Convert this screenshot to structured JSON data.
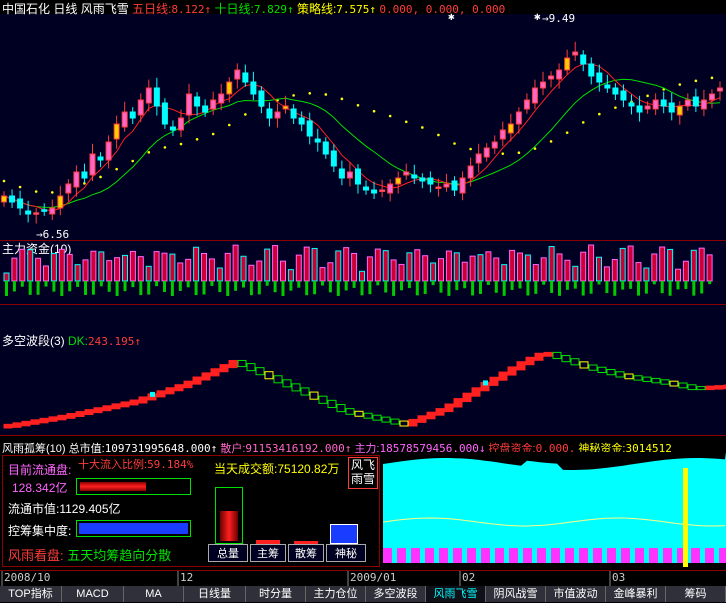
{
  "header": {
    "stock": "中国石化",
    "period": "日线",
    "indicator": "风雨飞雪",
    "ma5_label": "五日线:",
    "ma5_value": "8.122↑",
    "ma10_label": "十日线:",
    "ma10_value": "7.829↑",
    "strategy_label": "策略线:",
    "strategy_value": "7.575↑",
    "zeros": "0.000, 0.000, 0.000"
  },
  "price_chart": {
    "high_label": "9.49",
    "low_label": "6.56"
  },
  "panel2": {
    "title": "主力资金(10)"
  },
  "panel3": {
    "title": "多空波段(3)",
    "dk_label": "DK:",
    "dk_value": "243.195↑"
  },
  "panel4": {
    "title": "风雨孤筹(10)",
    "total_label": "总市值:",
    "total_value": "109731995648.000↑",
    "retail_label": "散户:",
    "retail_value": "91153416192.000↑",
    "main_label": "主力:",
    "main_value": "18578579456.000↓",
    "control_label": "控盘资金:",
    "control_value": "0.000,",
    "mystery_label": "神秘资金:",
    "mystery_value": "3014512"
  },
  "info_box": {
    "circ_label": "目前流通盘:",
    "inflow_label": "十大流入比例:",
    "inflow_value": "59.184%",
    "circ_value": "128.342亿",
    "today_label": "当天成交额:",
    "today_value": "75120.82万",
    "badge_line1": "风飞",
    "badge_line2": "雨雪",
    "mktcap_label": "流通市值:",
    "mktcap_value": "1129.405亿",
    "concentration_label": "控筹集中度:",
    "view_label": "风雨看盘:",
    "view_text": "五天均筹趋向分散",
    "buttons": [
      "总量",
      "主筹",
      "散筹",
      "神秘"
    ]
  },
  "time_axis": [
    "2008/10",
    "12",
    "2009/01",
    "02",
    "03"
  ],
  "tabs": [
    "TOP指标",
    "MACD",
    "MA",
    "日线量",
    "时分量",
    "主力仓位",
    "多空波段",
    "风雨飞雪",
    "阴风战雪",
    "市值波动",
    "金峰暴利",
    "筹码"
  ],
  "active_tab": "风雨飞雪",
  "colors": {
    "up": "#ff3c3c",
    "up_fill": "#ff66cc",
    "down": "#00ffff",
    "ma_green": "#00e000",
    "ma_red": "#ff2020",
    "dots": "#ffff00"
  },
  "chart_data": {
    "type": "candlestick",
    "ylim": [
      6.4,
      9.7
    ],
    "closes": [
      6.9,
      6.8,
      6.7,
      6.6,
      6.62,
      6.65,
      6.7,
      6.9,
      7.1,
      7.3,
      7.2,
      7.6,
      7.5,
      7.8,
      8.1,
      8.3,
      8.2,
      8.5,
      8.7,
      8.4,
      8.1,
      8.0,
      8.2,
      8.6,
      8.4,
      8.3,
      8.5,
      8.6,
      8.8,
      9.0,
      8.8,
      8.6,
      8.4,
      8.2,
      8.3,
      8.4,
      8.2,
      8.1,
      7.9,
      7.8,
      7.6,
      7.4,
      7.2,
      7.3,
      7.1,
      7.0,
      6.95,
      7.0,
      7.1,
      7.2,
      7.3,
      7.2,
      7.15,
      7.1,
      7.05,
      7.1,
      7.0,
      7.2,
      7.4,
      7.6,
      7.7,
      7.8,
      8.0,
      8.1,
      8.3,
      8.5,
      8.7,
      8.8,
      8.9,
      9.0,
      9.2,
      9.3,
      9.1,
      8.9,
      8.8,
      8.7,
      8.6,
      8.5,
      8.4,
      8.3,
      8.4,
      8.5,
      8.4,
      8.3,
      8.4,
      8.5,
      8.4,
      8.5,
      8.6,
      8.7
    ]
  }
}
